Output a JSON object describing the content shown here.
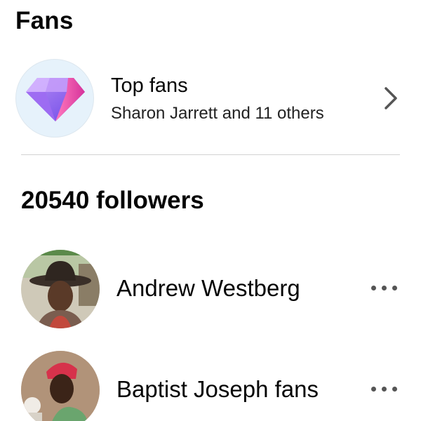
{
  "header": {
    "title": "Fans"
  },
  "top_fans": {
    "title": "Top fans",
    "subtitle": "Sharon Jarrett and 11 others",
    "icon": "diamond-icon",
    "chevron_icon": "chevron-right-icon"
  },
  "followers": {
    "heading": "20540 followers",
    "items": [
      {
        "name": "Andrew Westberg",
        "menu_icon": "more-horizontal-icon"
      },
      {
        "name": "Baptist Joseph fans",
        "menu_icon": "more-horizontal-icon"
      }
    ]
  },
  "colors": {
    "text": "#050505",
    "divider": "#d2d2d2",
    "diamond_bg": "#e6f2fb",
    "diamond_pink": "#e63c9a",
    "diamond_purple": "#8a52ee"
  }
}
